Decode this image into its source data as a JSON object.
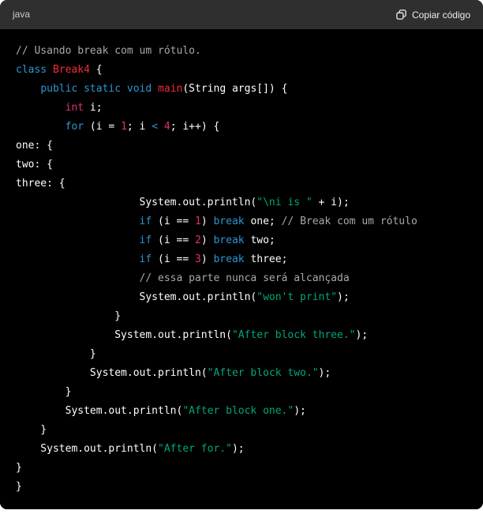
{
  "header": {
    "language": "java",
    "copy_label": "Copiar código",
    "copy_icon": "copy-icon"
  },
  "colors": {
    "page_bg": "#ffffff",
    "header_bg": "#2f2f2f",
    "header_text": "#c9c9d2",
    "copy_text": "#ececf1",
    "code_bg": "#000000",
    "plain": "#ffffff",
    "keyword": "#2e95d3",
    "title": "#f22c3d",
    "number_type": "#df3079",
    "string": "#00a67d",
    "comment": "#a9a9a9"
  },
  "code": {
    "lines": [
      [
        [
          "com",
          "// Usando break com um rótulo."
        ]
      ],
      [
        [
          "kw",
          "class"
        ],
        [
          "pl",
          " "
        ],
        [
          "ti",
          "Break4"
        ],
        [
          "pl",
          " {"
        ]
      ],
      [
        [
          "pl",
          "    "
        ],
        [
          "kw",
          "public"
        ],
        [
          "pl",
          " "
        ],
        [
          "kw",
          "static"
        ],
        [
          "pl",
          " "
        ],
        [
          "kw",
          "void"
        ],
        [
          "pl",
          " "
        ],
        [
          "ti",
          "main"
        ],
        [
          "pl",
          "(String args[]) {"
        ]
      ],
      [
        [
          "pl",
          "        "
        ],
        [
          "num",
          "int"
        ],
        [
          "pl",
          " i;"
        ]
      ],
      [
        [
          "pl",
          "        "
        ],
        [
          "kw",
          "for"
        ],
        [
          "pl",
          " (i = "
        ],
        [
          "num",
          "1"
        ],
        [
          "pl",
          "; i "
        ],
        [
          "kw",
          "<"
        ],
        [
          "pl",
          " "
        ],
        [
          "num",
          "4"
        ],
        [
          "pl",
          "; i++) {"
        ]
      ],
      [
        [
          "pl",
          "one: {"
        ]
      ],
      [
        [
          "pl",
          "two: {"
        ]
      ],
      [
        [
          "pl",
          "three: {"
        ]
      ],
      [
        [
          "pl",
          "                    System.out.println("
        ],
        [
          "str",
          "\"\\ni is \""
        ],
        [
          "pl",
          " + i);"
        ]
      ],
      [
        [
          "pl",
          "                    "
        ],
        [
          "kw",
          "if"
        ],
        [
          "pl",
          " (i == "
        ],
        [
          "num",
          "1"
        ],
        [
          "pl",
          ") "
        ],
        [
          "kw",
          "break"
        ],
        [
          "pl",
          " one; "
        ],
        [
          "com",
          "// Break com um rótulo"
        ]
      ],
      [
        [
          "pl",
          "                    "
        ],
        [
          "kw",
          "if"
        ],
        [
          "pl",
          " (i == "
        ],
        [
          "num",
          "2"
        ],
        [
          "pl",
          ") "
        ],
        [
          "kw",
          "break"
        ],
        [
          "pl",
          " two;"
        ]
      ],
      [
        [
          "pl",
          "                    "
        ],
        [
          "kw",
          "if"
        ],
        [
          "pl",
          " (i == "
        ],
        [
          "num",
          "3"
        ],
        [
          "pl",
          ") "
        ],
        [
          "kw",
          "break"
        ],
        [
          "pl",
          " three;"
        ]
      ],
      [
        [
          "pl",
          "                    "
        ],
        [
          "com",
          "// essa parte nunca será alcançada"
        ]
      ],
      [
        [
          "pl",
          "                    System.out.println("
        ],
        [
          "str",
          "\"won't print\""
        ],
        [
          "pl",
          ");"
        ]
      ],
      [
        [
          "pl",
          "                }"
        ]
      ],
      [
        [
          "pl",
          "                System.out.println("
        ],
        [
          "str",
          "\"After block three.\""
        ],
        [
          "pl",
          ");"
        ]
      ],
      [
        [
          "pl",
          "            }"
        ]
      ],
      [
        [
          "pl",
          "            System.out.println("
        ],
        [
          "str",
          "\"After block two.\""
        ],
        [
          "pl",
          ");"
        ]
      ],
      [
        [
          "pl",
          "        }"
        ]
      ],
      [
        [
          "pl",
          "        System.out.println("
        ],
        [
          "str",
          "\"After block one.\""
        ],
        [
          "pl",
          ");"
        ]
      ],
      [
        [
          "pl",
          "    }"
        ]
      ],
      [
        [
          "pl",
          "    System.out.println("
        ],
        [
          "str",
          "\"After for.\""
        ],
        [
          "pl",
          ");"
        ]
      ],
      [
        [
          "pl",
          "}"
        ]
      ],
      [
        [
          "pl",
          "}"
        ]
      ]
    ]
  }
}
